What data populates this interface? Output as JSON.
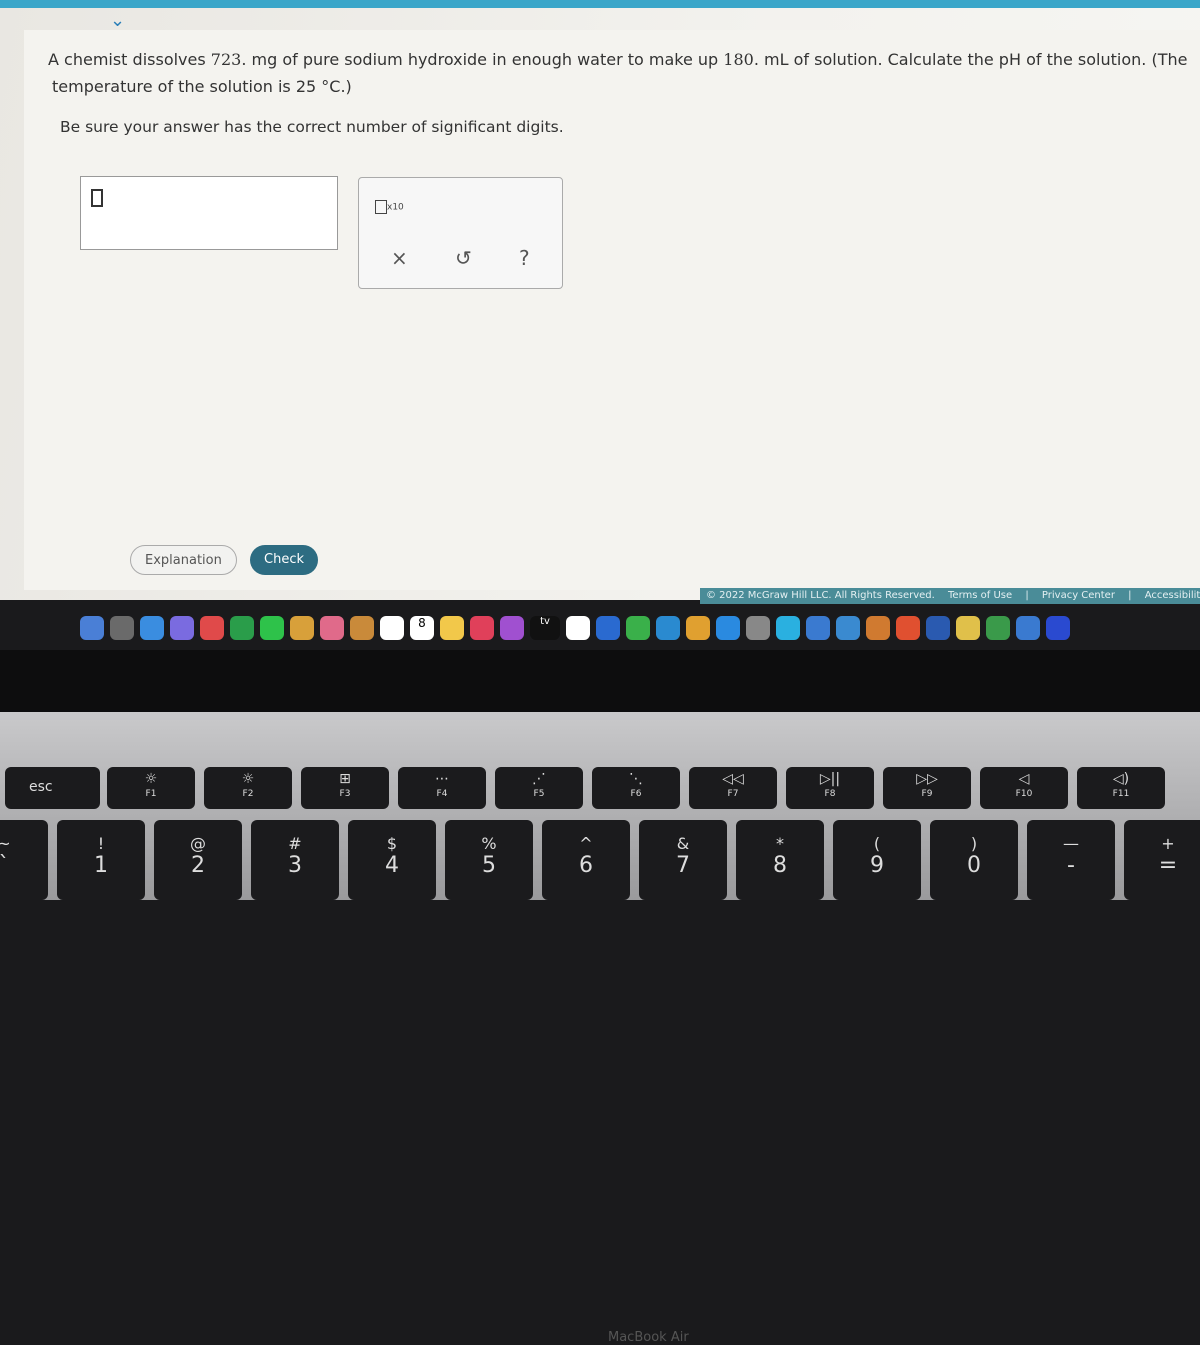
{
  "question": {
    "line1_pre": "A chemist dissolves ",
    "mass": "723.",
    "line1_mid": " mg of pure sodium hydroxide in enough water to make up ",
    "volume": "180.",
    "line1_post": " mL of solution. Calculate the pH of the solution. (The",
    "line2": "temperature of the solution is 25 °C.)",
    "instruction": "Be sure your answer has the correct number of significant digits."
  },
  "answer": {
    "value": ""
  },
  "tools": {
    "x10": "x10",
    "clear": "×",
    "undo": "↺",
    "help": "?"
  },
  "buttons": {
    "explanation": "Explanation",
    "check": "Check"
  },
  "footer": {
    "copyright": "© 2022 McGraw Hill LLC. All Rights Reserved.",
    "terms": "Terms of Use",
    "privacy": "Privacy Center",
    "accessibility": "Accessibility",
    "sep": "|"
  },
  "dock": {
    "calendar_day": "8",
    "tv": "tv"
  },
  "bezel": {
    "label": "MacBook Air"
  },
  "keyboard": {
    "fn": [
      [
        "esc",
        ""
      ],
      [
        "F1",
        "☼"
      ],
      [
        "F2",
        "☼"
      ],
      [
        "F3",
        "⊞"
      ],
      [
        "F4",
        "⋯"
      ],
      [
        "F5",
        "⋰"
      ],
      [
        "F6",
        "⋱"
      ],
      [
        "F7",
        "◁◁"
      ],
      [
        "F8",
        "▷||"
      ],
      [
        "F9",
        "▷▷"
      ],
      [
        "F10",
        "◁"
      ],
      [
        "F11",
        "◁)"
      ]
    ],
    "num": [
      [
        "~",
        "`"
      ],
      [
        "!",
        "1"
      ],
      [
        "@",
        "2"
      ],
      [
        "#",
        "3"
      ],
      [
        "$",
        "4"
      ],
      [
        "%",
        "5"
      ],
      [
        "^",
        "6"
      ],
      [
        "&",
        "7"
      ],
      [
        "*",
        "8"
      ],
      [
        "(",
        "9"
      ],
      [
        ")",
        "0"
      ],
      [
        "—",
        "-"
      ],
      [
        "+",
        "="
      ]
    ]
  }
}
